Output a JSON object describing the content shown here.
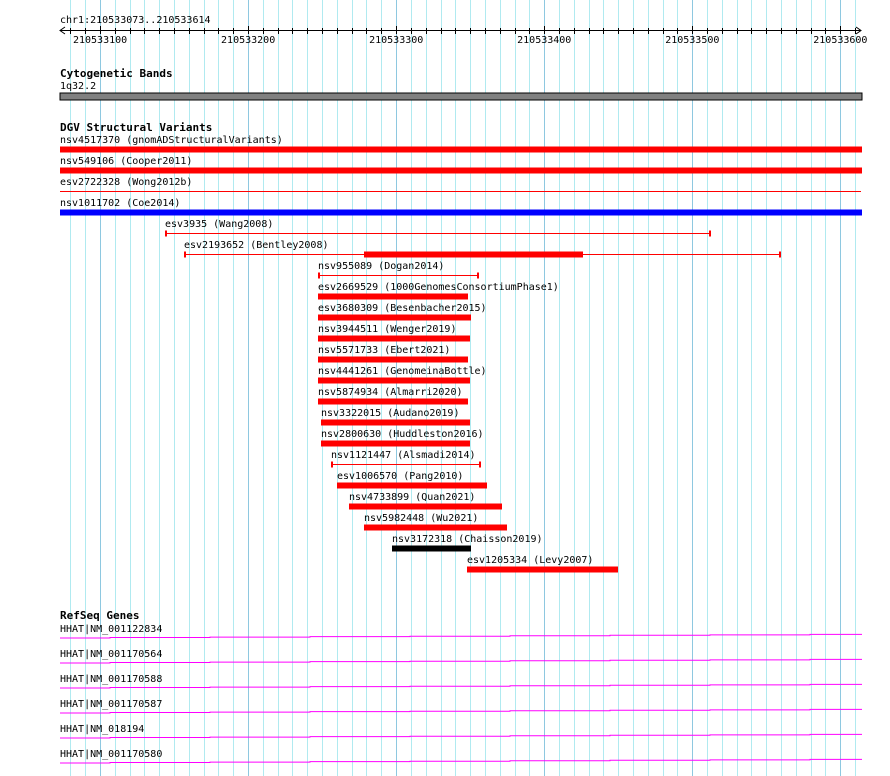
{
  "ruler": {
    "region_label": "chr1:210533073..210533614",
    "start": 210533073,
    "end": 210533614,
    "ticks": [
      "210533100",
      "210533200",
      "210533300",
      "210533400",
      "210533500",
      "210533600"
    ]
  },
  "cytoband": {
    "title": "Cytogenetic Bands",
    "band": "1q32.2",
    "color": "#808080"
  },
  "dgv": {
    "title": "DGV Structural Variants",
    "features": [
      {
        "label": "nsv4517370 (gnomADStructuralVariants)",
        "start": 210533073,
        "end": 210533614,
        "style": "thick",
        "color": "#ff0000"
      },
      {
        "label": "nsv549106 (Cooper2011)",
        "start": 210533073,
        "end": 210533614,
        "style": "thick",
        "color": "#ff0000"
      },
      {
        "label": "esv2722328 (Wong2012b)",
        "start": 210533073,
        "end": 210533614,
        "style": "line",
        "color": "#ff0000"
      },
      {
        "label": "nsv1011702 (Coe2014)",
        "start": 210533073,
        "end": 210533614,
        "style": "thick",
        "color": "#0000ff"
      },
      {
        "label": "esv3935 (Wang2008)",
        "start": 210533144,
        "end": 210533512,
        "style": "capped",
        "color": "#ff0000"
      },
      {
        "label": "esv2193652 (Bentley2008)",
        "start": 210533157,
        "end": 210533559,
        "style": "capped",
        "color": "#ff0000",
        "inner_start": 210533278,
        "inner_end": 210533426
      },
      {
        "label": "nsv955089 (Dogan2014)",
        "start": 210533247,
        "end": 210533355,
        "style": "capped",
        "color": "#ff0000"
      },
      {
        "label": "esv2669529 (1000GenomesConsortiumPhase1)",
        "start": 210533247,
        "end": 210533348,
        "style": "thick",
        "color": "#ff0000"
      },
      {
        "label": "esv3680309 (Besenbacher2015)",
        "start": 210533247,
        "end": 210533350,
        "style": "thick",
        "color": "#ff0000"
      },
      {
        "label": "nsv3944511 (Wenger2019)",
        "start": 210533247,
        "end": 210533349,
        "style": "thick",
        "color": "#ff0000"
      },
      {
        "label": "nsv5571733 (Ebert2021)",
        "start": 210533247,
        "end": 210533348,
        "style": "thick",
        "color": "#ff0000"
      },
      {
        "label": "nsv4441261 (GenomeinaBottle)",
        "start": 210533247,
        "end": 210533349,
        "style": "thick",
        "color": "#ff0000"
      },
      {
        "label": "nsv5874934 (Almarri2020)",
        "start": 210533247,
        "end": 210533348,
        "style": "thick",
        "color": "#ff0000"
      },
      {
        "label": "nsv3322015 (Audano2019)",
        "start": 210533249,
        "end": 210533349,
        "style": "thick",
        "color": "#ff0000"
      },
      {
        "label": "nsv2800630 (Huddleston2016)",
        "start": 210533249,
        "end": 210533349,
        "style": "thick",
        "color": "#ff0000"
      },
      {
        "label": "nsv1121447 (Alsmadi2014)",
        "start": 210533256,
        "end": 210533357,
        "style": "capped",
        "color": "#ff0000"
      },
      {
        "label": "esv1006570 (Pang2010)",
        "start": 210533260,
        "end": 210533361,
        "style": "thick",
        "color": "#ff0000"
      },
      {
        "label": "nsv4733899 (Quan2021)",
        "start": 210533268,
        "end": 210533371,
        "style": "thick",
        "color": "#ff0000"
      },
      {
        "label": "nsv5982448 (Wu2021)",
        "start": 210533278,
        "end": 210533374,
        "style": "thick",
        "color": "#ff0000"
      },
      {
        "label": "nsv3172318 (Chaisson2019)",
        "start": 210533297,
        "end": 210533350,
        "style": "thick",
        "color": "#000000"
      },
      {
        "label": "esv1205334 (Levy2007)",
        "start": 210533348,
        "end": 210533449,
        "style": "thick",
        "color": "#ff0000"
      }
    ]
  },
  "refseq": {
    "title": "RefSeq Genes",
    "color": "#ff00ff",
    "genes": [
      "HHAT|NM_001122834",
      "HHAT|NM_001170564",
      "HHAT|NM_001170588",
      "HHAT|NM_001170587",
      "HHAT|NM_018194",
      "HHAT|NM_001170580"
    ]
  }
}
